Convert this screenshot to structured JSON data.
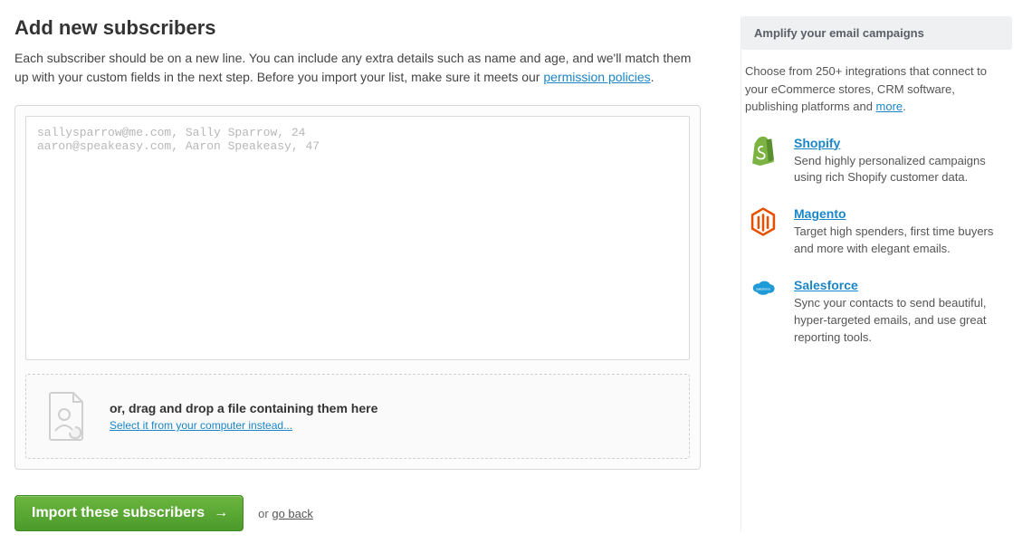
{
  "heading": "Add new subscribers",
  "intro_prefix": "Each subscriber should be on a new line. You can include any extra details such as name and age, and we'll match them up with your custom fields in the next step. Before you import your list, make sure it meets our ",
  "intro_link": "permission policies",
  "intro_suffix": ".",
  "textarea_placeholder": "sallysparrow@me.com, Sally Sparrow, 24\naaron@speakeasy.com, Aaron Speakeasy, 47",
  "dropzone": {
    "title": "or, drag and drop a file containing them here",
    "select_link": "Select it from your computer instead..."
  },
  "actions": {
    "import_label": "Import these subscribers",
    "or": "or ",
    "goback": "go back"
  },
  "sidebar": {
    "header": "Amplify your email campaigns",
    "intro_prefix": "Choose from 250+ integrations that connect to your eCommerce stores, CRM software, publishing platforms and ",
    "intro_link": "more",
    "intro_suffix": ".",
    "integrations": [
      {
        "name": "Shopify",
        "desc": "Send highly personalized campaigns using rich Shopify customer data."
      },
      {
        "name": "Magento",
        "desc": "Target high spenders, first time buyers and more with elegant emails."
      },
      {
        "name": "Salesforce",
        "desc": "Sync your contacts to send beautiful, hyper-targeted emails, and use great reporting tools."
      }
    ]
  }
}
